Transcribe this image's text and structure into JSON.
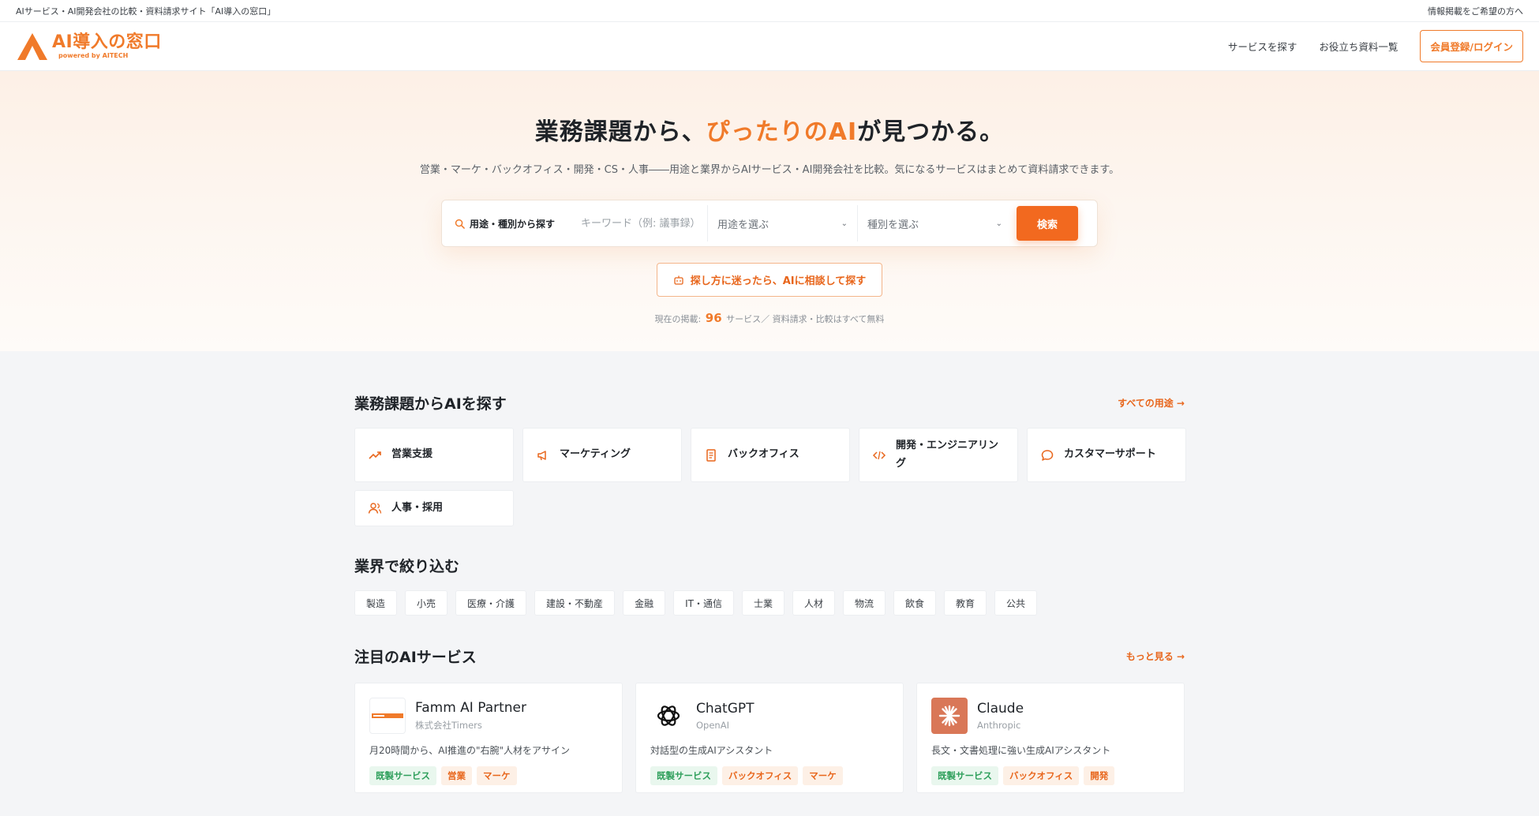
{
  "topbar": {
    "left": "AIサービス・AI開発会社の比較・資料請求サイト「AI導入の窓口」",
    "right": "情報掲載をご希望の方へ"
  },
  "header": {
    "logo_title": "AI導入の窓口",
    "logo_sub": "powered by AITECH",
    "nav": [
      "サービスを探す",
      "お役立ち資料一覧"
    ],
    "login": "会員登録/ログイン"
  },
  "hero": {
    "title_pre": "業務課題から、",
    "title_accent": "ぴったりのAI",
    "title_post": "が見つかる。",
    "desc": "営業・マーケ・バックオフィス・開発・CS・人事――用途と業界からAIサービス・AI開発会社を比較。気になるサービスはまとめて資料請求できます。",
    "search_label": "用途・種別から探す",
    "keyword_placeholder": "キーワード（例: 議事録）",
    "select_usage": "用途を選ぶ",
    "select_type": "種別を選ぶ",
    "search_button": "検索",
    "ai_button": "探し方に迷ったら、AIに相談して探す",
    "count_pre": "現在の掲載:",
    "count_num": "96",
    "count_post": "サービス／ 資料請求・比較はすべて無料"
  },
  "categories": {
    "title": "業務課題からAIを探す",
    "link": "すべての用途 →",
    "items": [
      {
        "label": "営業支援",
        "icon": "trending-up-icon"
      },
      {
        "label": "マーケティング",
        "icon": "megaphone-icon"
      },
      {
        "label": "バックオフィス",
        "icon": "document-icon"
      },
      {
        "label": "開発・エンジニアリング",
        "icon": "code-icon"
      },
      {
        "label": "カスタマーサポート",
        "icon": "chat-bubble-icon"
      },
      {
        "label": "人事・採用",
        "icon": "users-icon"
      }
    ]
  },
  "industries": {
    "title": "業界で絞り込む",
    "items": [
      "製造",
      "小売",
      "医療・介護",
      "建設・不動産",
      "金融",
      "IT・通信",
      "士業",
      "人材",
      "物流",
      "飲食",
      "教育",
      "公共"
    ]
  },
  "featured": {
    "title": "注目のAIサービス",
    "link": "もっと見る →",
    "cards": [
      {
        "name": "Famm AI Partner",
        "company": "株式会社Timers",
        "desc": "月20時間から、AI推進の\"右腕\"人材をアサイン",
        "tags": [
          "既製サービス",
          "営業",
          "マーケ"
        ]
      },
      {
        "name": "ChatGPT",
        "company": "OpenAI",
        "desc": "対話型の生成AIアシスタント",
        "tags": [
          "既製サービス",
          "バックオフィス",
          "マーケ"
        ]
      },
      {
        "name": "Claude",
        "company": "Anthropic",
        "desc": "長文・文書処理に強い生成AIアシスタント",
        "tags": [
          "既製サービス",
          "バックオフィス",
          "開発"
        ]
      }
    ]
  },
  "colors": {
    "accent": "#f07a2a",
    "button": "#f2691f",
    "tag_green": "#2e9f5b"
  }
}
